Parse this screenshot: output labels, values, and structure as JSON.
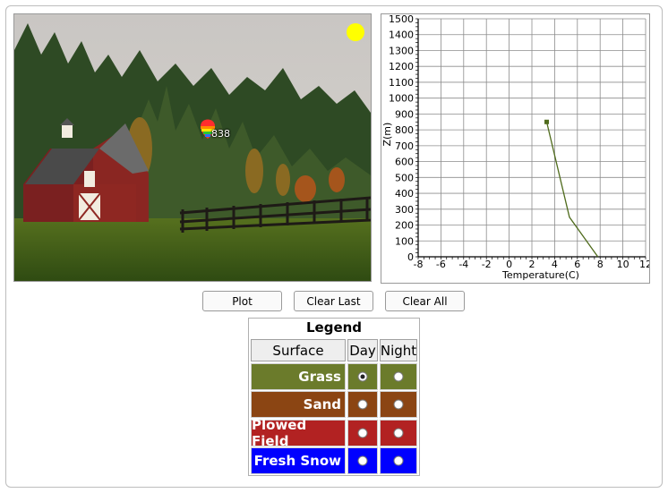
{
  "scene": {
    "balloon_altitude_label": "838",
    "sun_color": "#ffff00"
  },
  "chart_data": {
    "type": "line",
    "xlabel": "Temperature(C)",
    "ylabel": "Z(m)",
    "xlim": [
      -8,
      12
    ],
    "ylim": [
      0,
      1500
    ],
    "x_ticks": [
      "-8",
      "-6",
      "-4",
      "-2",
      "0",
      "2",
      "4",
      "6",
      "8",
      "10",
      "12"
    ],
    "y_ticks": [
      "0",
      "100",
      "200",
      "300",
      "400",
      "500",
      "600",
      "700",
      "800",
      "900",
      "1000",
      "1100",
      "1200",
      "1300",
      "1400",
      "1500"
    ],
    "grid": true,
    "series": [
      {
        "color": "#4f6b1c",
        "points": [
          [
            7.8,
            0
          ],
          [
            5.3,
            250
          ],
          [
            3.3,
            850
          ]
        ]
      }
    ],
    "marker": {
      "x": 3.3,
      "y": 850,
      "shape": "square"
    }
  },
  "buttons": {
    "plot": "Plot",
    "clear_last": "Clear Last",
    "clear_all": "Clear All"
  },
  "legend": {
    "title": "Legend",
    "headers": {
      "surface": "Surface",
      "day": "Day",
      "night": "Night"
    },
    "rows": [
      {
        "label": "Grass",
        "color": "#6b7b2b",
        "day_selected": true,
        "night_selected": false
      },
      {
        "label": "Sand",
        "color": "#8b4513",
        "day_selected": false,
        "night_selected": false
      },
      {
        "label": "Plowed Field",
        "color": "#b22222",
        "day_selected": false,
        "night_selected": false
      },
      {
        "label": "Fresh Snow",
        "color": "#0000ff",
        "day_selected": false,
        "night_selected": false
      }
    ]
  }
}
